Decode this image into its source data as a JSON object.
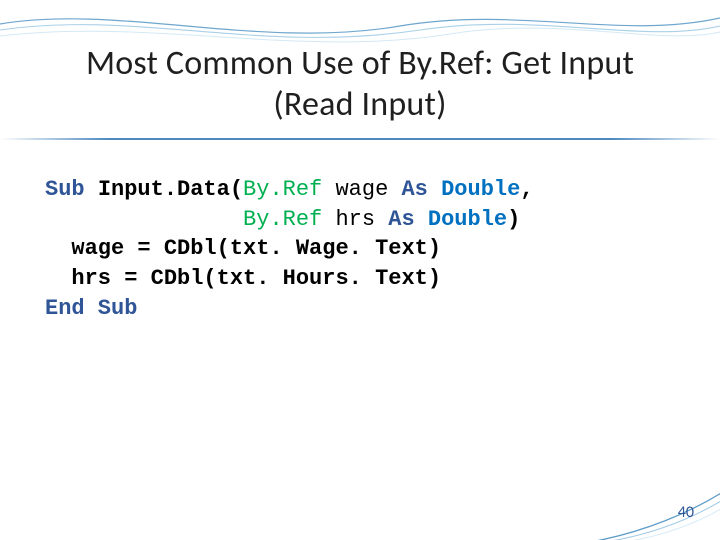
{
  "title_line1": "Most Common Use of By.Ref: Get Input",
  "title_line2": "(Read Input)",
  "code": {
    "l1": {
      "sub": "Sub ",
      "name": "Input.Data(",
      "byref": "By.Ref ",
      "var": "wage ",
      "as": "As ",
      "type": "Double",
      "comma": ","
    },
    "l2": {
      "pad": "               ",
      "byref": "By.Ref ",
      "var": "hrs ",
      "as": "As ",
      "type": "Double",
      "paren": ")"
    },
    "l3": {
      "pad": "  ",
      "lhs": "wage = ",
      "fn": "CDbl(",
      "arg": "txt. Wage. Text)"
    },
    "l4": {
      "pad": "  ",
      "lhs": "hrs = ",
      "fn": "CDbl(",
      "arg": "txt. Hours. Text)"
    },
    "l5": {
      "end": "End Sub"
    }
  },
  "page_number": "40"
}
